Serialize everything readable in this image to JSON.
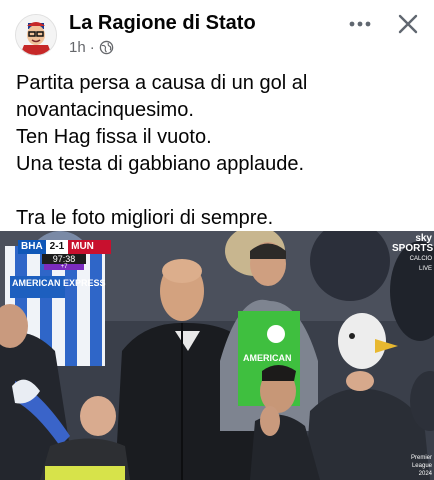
{
  "header": {
    "page_name": "La Ragione di Stato",
    "time": "1h",
    "separator": "·",
    "privacy_icon": "globe-icon",
    "more_icon": "more-horizontal-icon",
    "close_icon": "close-icon"
  },
  "post": {
    "lines": [
      "Partita persa a causa di un gol al",
      "novantacinquesimo.",
      "Ten Hag fissa il vuoto.",
      "Una testa di gabbiano applaude."
    ],
    "closing_line": "Tra le foto migliori di sempre."
  },
  "photo": {
    "scorebug": {
      "home": "BHA",
      "score": "2-1",
      "away": "MUN",
      "time": "97:38",
      "added": "+7"
    },
    "broadcaster": {
      "line1": "sky SPORTS",
      "line2": "CALCIO",
      "line3": "LIVE"
    },
    "jersey_text": "AMERICAN EXPRESS",
    "vest_text": "AMERICAN",
    "watermark": "Premier League 2024",
    "colors": {
      "home": "#0f57b8",
      "away": "#c8102e",
      "added_time": "#7b2cbf",
      "vest": "#3fbf3f"
    }
  }
}
